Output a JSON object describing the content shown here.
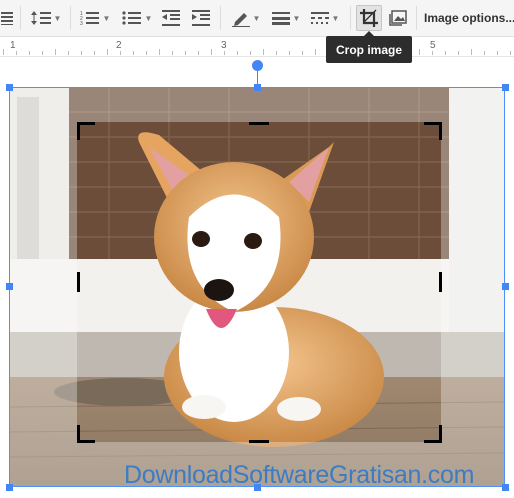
{
  "toolbar": {
    "image_options_label": "Image options..."
  },
  "ruler": {
    "numbers": [
      "1",
      "2",
      "3",
      "5"
    ]
  },
  "tooltip": {
    "text": "Crop image"
  },
  "watermark": {
    "text": "DownloadSoftwareGratisan.com"
  },
  "colors": {
    "accent": "#4285f4",
    "tooltip_bg": "#2d2d2d",
    "watermark": "#3b7cc4"
  },
  "icons": [
    "align-justify-icon",
    "line-spacing-icon",
    "numbered-list-icon",
    "bulleted-list-icon",
    "decrease-indent-icon",
    "increase-indent-icon",
    "pen-color-icon",
    "line-weight-icon",
    "line-dash-icon",
    "crop-icon",
    "replace-image-icon"
  ]
}
